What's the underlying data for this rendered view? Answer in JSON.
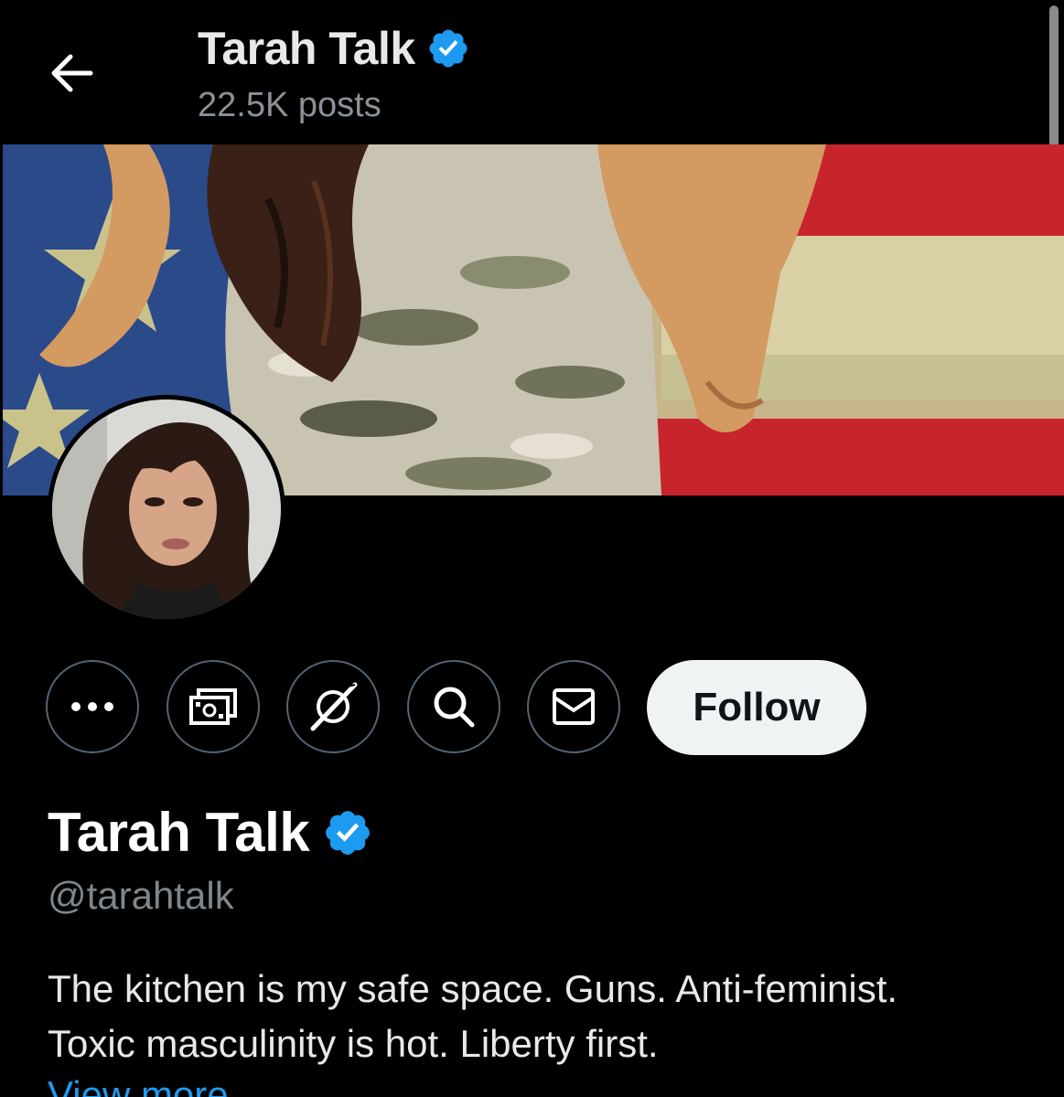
{
  "header": {
    "title": "Tarah Talk",
    "posts_count": "22.5K posts"
  },
  "profile": {
    "display_name": "Tarah Talk",
    "handle": "@tarahtalk",
    "verified": true,
    "bio_line1": "The kitchen is my safe space. Guns. Anti-feminist.",
    "bio_line2": "Toxic masculinity is hot. Liberty first.",
    "view_more": "View more"
  },
  "actions": {
    "more": "more-horizontal-icon",
    "subscribe": "money-icon",
    "grok": "grok-icon",
    "search": "search-icon",
    "message": "envelope-icon",
    "follow_label": "Follow"
  },
  "colors": {
    "background": "#000000",
    "verified_blue": "#1d9bf0",
    "muted_text": "#7e868c",
    "follow_bg": "#eff3f4"
  }
}
